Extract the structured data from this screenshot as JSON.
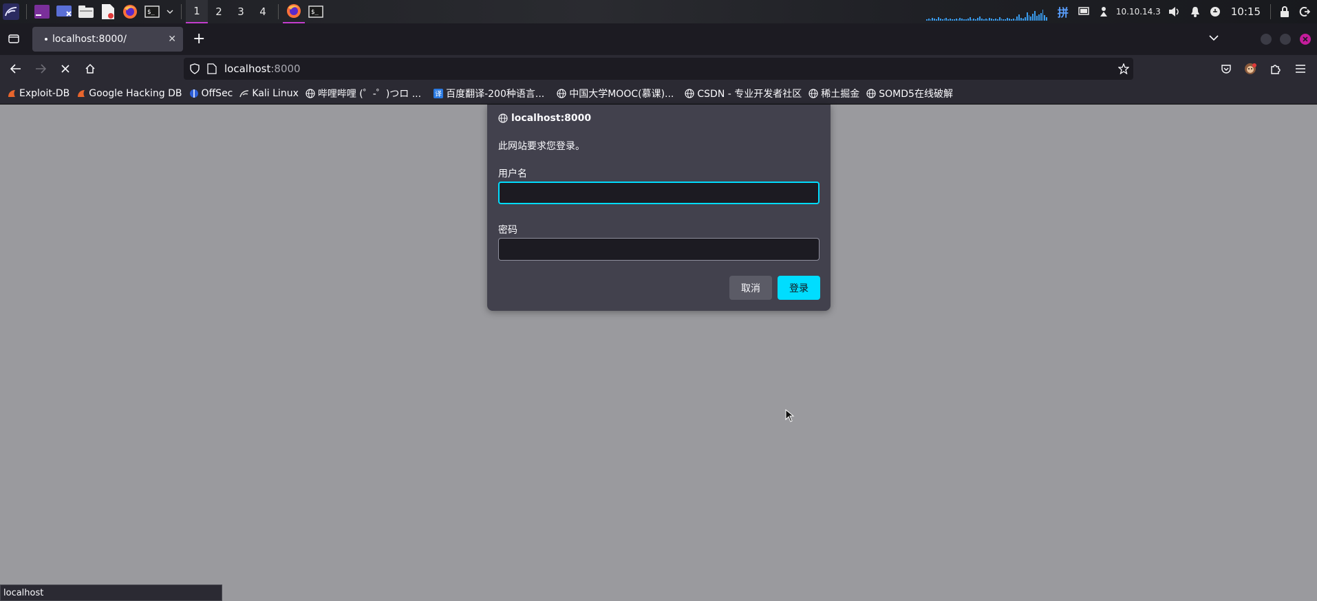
{
  "taskbar": {
    "workspaces": [
      "1",
      "2",
      "3",
      "4"
    ],
    "active_workspace": "1",
    "ip_address": "10.10.14.3",
    "input_method": "拼",
    "clock": "10:15",
    "icons": [
      "kali-menu-icon",
      "terminal-launcher-icon",
      "desktop-switch-icon",
      "file-manager-icon",
      "text-editor-icon",
      "firefox-launcher-icon",
      "terminal-icon",
      "chevron-down-icon"
    ]
  },
  "browser": {
    "tab": {
      "title": "localhost:8000/",
      "loading": true
    },
    "url": {
      "host": "localhost",
      "port": ":8000"
    },
    "accent": "#00ddff"
  },
  "bookmarks": [
    {
      "label": "Exploit-DB",
      "icon": "exploitdb-icon"
    },
    {
      "label": "Google Hacking DB",
      "icon": "ghdb-icon"
    },
    {
      "label": "OffSec",
      "icon": "offsec-icon"
    },
    {
      "label": "Kali Linux",
      "icon": "kali-icon"
    },
    {
      "label": "哔哩哔哩 (゜-゜)つロ ...",
      "icon": "globe-icon"
    },
    {
      "label": "百度翻译-200种语言...",
      "icon": "baidu-translate-icon"
    },
    {
      "label": "中国大学MOOC(慕课)...",
      "icon": "globe-icon"
    },
    {
      "label": "CSDN - 专业开发者社区",
      "icon": "globe-icon"
    },
    {
      "label": "稀土掘金",
      "icon": "globe-icon"
    },
    {
      "label": "SOMD5在线破解",
      "icon": "globe-icon"
    }
  ],
  "dialog": {
    "origin": "localhost:8000",
    "message": "此网站要求您登录。",
    "username_label": "用户名",
    "username_value": "",
    "password_label": "密码",
    "password_value": "",
    "cancel_label": "取消",
    "login_label": "登录"
  },
  "status_bar": {
    "text": "localhost"
  }
}
